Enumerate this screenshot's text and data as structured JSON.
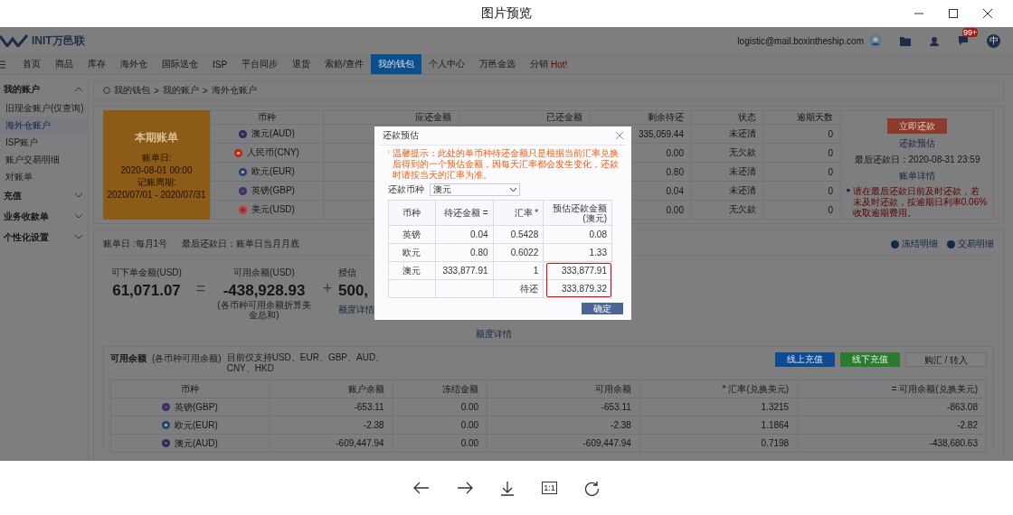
{
  "window": {
    "title": "图片预览"
  },
  "site": {
    "logo": "INIT万邑联",
    "email": "logistic@mail.boxintheship.com",
    "chat_badge": "99+",
    "language": "中"
  },
  "nav": [
    {
      "label": "首页",
      "selected": false
    },
    {
      "label": "商品",
      "selected": false
    },
    {
      "label": "库存",
      "selected": false
    },
    {
      "label": "海外仓",
      "selected": false
    },
    {
      "label": "国际送仓",
      "selected": false
    },
    {
      "label": "ISP",
      "selected": false
    },
    {
      "label": "平台同步",
      "selected": false
    },
    {
      "label": "退货",
      "selected": false
    },
    {
      "label": "索赔/查件",
      "selected": false
    },
    {
      "label": "我的钱包",
      "selected": true
    },
    {
      "label": "个人中心",
      "selected": false
    },
    {
      "label": "万邑金选",
      "selected": false
    },
    {
      "label": "分销",
      "tag": "Hot!",
      "selected": false
    }
  ],
  "sidebar": [
    {
      "label": "我的账户",
      "expanded": true,
      "children": [
        {
          "label": "旧现金账户(仅查询)",
          "selected": false
        },
        {
          "label": "海外仓账户",
          "selected": true
        },
        {
          "label": "ISP账户",
          "selected": false
        },
        {
          "label": "账户交易明细",
          "selected": false
        },
        {
          "label": "对账单",
          "selected": false
        }
      ]
    },
    {
      "label": "充值",
      "expanded": false
    },
    {
      "label": "业务收款单",
      "expanded": false
    },
    {
      "label": "个性化设置",
      "expanded": false
    }
  ],
  "breadcrumb": {
    "items": [
      "我的钱包",
      "我的账户",
      "海外仓账户"
    ],
    "separator": ">"
  },
  "bill": {
    "card": {
      "title": "本期账单",
      "date_label": "账单日:",
      "date": "2020-08-01 00:00",
      "period_label": "记账周期:",
      "period": "2020/07/01 - 2020/07/31"
    },
    "columns": [
      "币种",
      "应还金额",
      "已还金额",
      "剩余待还",
      "状态",
      "逾期天数"
    ],
    "rows": [
      {
        "kind": "au",
        "currency": "澳元(AUD)",
        "remaining": "335,059.44",
        "status": "未还清",
        "overdue_days": "0"
      },
      {
        "kind": "cn",
        "currency": "人民币(CNY)",
        "remaining": "0.00",
        "status": "无欠款",
        "overdue_days": "0"
      },
      {
        "kind": "eu",
        "currency": "欧元(EUR)",
        "remaining": "0.80",
        "status": "未还清",
        "overdue_days": "0"
      },
      {
        "kind": "gb",
        "currency": "英镑(GBP)",
        "remaining": "0.04",
        "status": "未还清",
        "overdue_days": "0"
      },
      {
        "kind": "us",
        "currency": "美元(USD)",
        "remaining": "0.00",
        "status": "无欠款",
        "overdue_days": "0"
      }
    ],
    "actions": {
      "pay_button": "立即还款",
      "estimate_link": "还款预估",
      "due": "最后还款日：2020-08-31 23:59",
      "detail_link": "账单详情",
      "warning": "请在最后还款日前及时还款，若未及时还款，按逾期日利率0.06%收取逾期费用。"
    }
  },
  "summary": {
    "bill_day": "账单日 :每月1号",
    "last_day": "最后还款日：账单日当月月底",
    "links": [
      "冻结明细",
      "交易明细"
    ],
    "orderable": {
      "label": "可下单金额(USD)",
      "value": "61,071.07"
    },
    "equals": "=",
    "available": {
      "label": "可用余额(USD)",
      "value": "-438,928.93",
      "note": "(各币种可用余额折算美金总和)"
    },
    "plus": "+",
    "credit": {
      "label": "授信",
      "value": "500,",
      "link": "额度详情"
    },
    "credit_link_2": "额度详情"
  },
  "balance": {
    "title": "可用余额",
    "subtitle": "(各币种可用余额)",
    "support": "目前仅支持USD、EUR、GBP、AUD、CNY、HKD",
    "buttons": [
      "线上充值",
      "线下充值",
      "购汇 / 转入"
    ],
    "columns": [
      "币种",
      "账户余额",
      "冻结金额",
      "可用余额",
      "* 汇率(兑换美元)",
      "= 可用余额(兑换美元)"
    ],
    "rows": [
      {
        "kind": "gb",
        "cells": [
          "英镑(GBP)",
          "-653.11",
          "0.00",
          "-653.11",
          "1.3215",
          "-863.08"
        ]
      },
      {
        "kind": "eu",
        "cells": [
          "欧元(EUR)",
          "-2.38",
          "0.00",
          "-2.38",
          "1.1864",
          "-2.82"
        ]
      },
      {
        "kind": "au",
        "cells": [
          "澳元(AUD)",
          "-609,447.94",
          "0.00",
          "-609,447.94",
          "0.7198",
          "-438,680.63"
        ]
      }
    ]
  },
  "modal": {
    "title": "还款预估",
    "hint": "温馨提示：此处的单币种待还金额只是根据当前汇率兑换后得到的一个预估金额，因每天汇率都会发生变化，还款时请按当天的汇率为准。",
    "currency_label": "还款币种",
    "currency_value": "澳元",
    "columns": [
      "币种",
      "待还金额 =",
      "汇率 *",
      "预估还款金额(澳元)"
    ],
    "rows": [
      {
        "cells": [
          "英镑",
          "0.04",
          "0.5428",
          "0.08"
        ]
      },
      {
        "cells": [
          "欧元",
          "0.80",
          "0.6022",
          "1.33"
        ]
      },
      {
        "cells": [
          "澳元",
          "333,877.91",
          "1",
          "333,877.91"
        ]
      }
    ],
    "total_label": "待还",
    "total": "333,879.32",
    "highlighted": true,
    "ok_button": "确定"
  },
  "toolbar": {
    "zoom_label": "1:1"
  }
}
